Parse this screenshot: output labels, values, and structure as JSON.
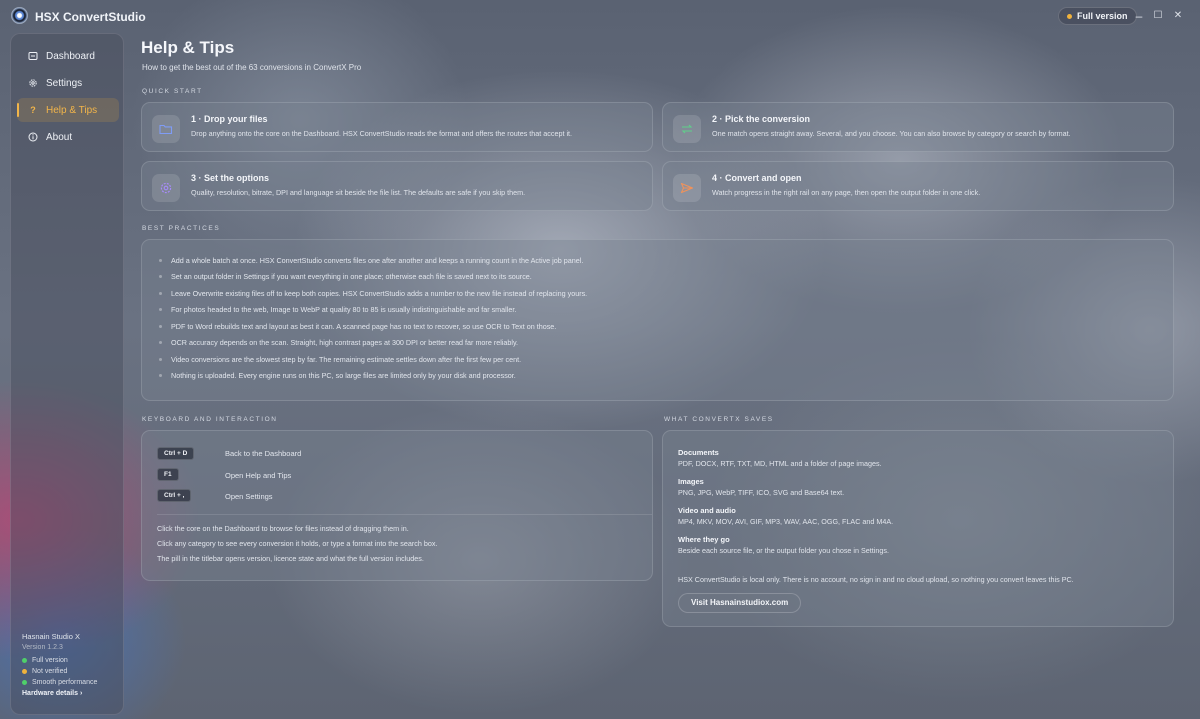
{
  "titlebar": {
    "app_title": "HSX ConvertStudio",
    "version_pill": "Full version",
    "pill_color": "#f0b23c",
    "controls": {
      "minimize": "–",
      "maximize": "☐",
      "close": "✕"
    }
  },
  "sidebar": {
    "items": [
      {
        "label": "Dashboard",
        "icon": "dashboard-icon",
        "active": false
      },
      {
        "label": "Settings",
        "icon": "gear-icon",
        "active": false
      },
      {
        "label": "Help & Tips",
        "icon": "help-icon",
        "active": true
      },
      {
        "label": "About",
        "icon": "info-icon",
        "active": false
      }
    ],
    "footer": {
      "brand": "Hasnain Studio X",
      "version": "Version 1.2.3",
      "statuses": [
        {
          "label": "Full version",
          "color": "#4fcf6a"
        },
        {
          "label": "Not verified",
          "color": "#f0b23c"
        },
        {
          "label": "Smooth performance",
          "color": "#4fcf6a"
        }
      ],
      "hardware_link": "Hardware details ›"
    }
  },
  "page": {
    "title": "Help & Tips",
    "subtitle": "How to get the best out of the 63 conversions in ConvertX Pro"
  },
  "quick_start": {
    "label": "QUICK START",
    "cards": [
      {
        "title": "1 · Drop your files",
        "text": "Drop anything onto the core on the Dashboard. HSX ConvertStudio reads the format and offers the routes that accept it.",
        "icon": "folder-icon",
        "color": "#7f9cf5"
      },
      {
        "title": "2 · Pick the conversion",
        "text": "One match opens straight away. Several, and you choose. You can also browse by category or search by format.",
        "icon": "swap-icon",
        "color": "#5fd08a"
      },
      {
        "title": "3 · Set the options",
        "text": "Quality, resolution, bitrate, DPI and language sit beside the file list. The defaults are safe if you skip them.",
        "icon": "gear-icon",
        "color": "#a78bfa"
      },
      {
        "title": "4 · Convert and open",
        "text": "Watch progress in the right rail on any page, then open the output folder in one click.",
        "icon": "send-icon",
        "color": "#f0925a"
      }
    ]
  },
  "best_practices": {
    "label": "BEST PRACTICES",
    "items": [
      "Add a whole batch at once. HSX ConvertStudio converts files one after another and keeps a running count in the Active job panel.",
      "Set an output folder in Settings if you want everything in one place; otherwise each file is saved next to its source.",
      "Leave Overwrite existing files off to keep both copies. HSX ConvertStudio adds a number to the new file instead of replacing yours.",
      "For photos headed to the web, Image to WebP at quality 80 to 85 is usually indistinguishable and far smaller.",
      "PDF to Word rebuilds text and layout as best it can. A scanned page has no text to recover, so use OCR to Text on those.",
      "OCR accuracy depends on the scan. Straight, high contrast pages at 300 DPI or better read far more reliably.",
      "Video conversions are the slowest step by far. The remaining estimate settles down after the first few per cent.",
      "Nothing is uploaded. Every engine runs on this PC, so large files are limited only by your disk and processor."
    ]
  },
  "keyboard": {
    "label": "KEYBOARD AND INTERACTION",
    "shortcuts": [
      {
        "key": "Ctrl + D",
        "desc": "Back to the Dashboard"
      },
      {
        "key": "F1",
        "desc": "Open Help and Tips"
      },
      {
        "key": "Ctrl + ,",
        "desc": "Open Settings"
      }
    ],
    "notes": [
      "Click the core on the Dashboard to browse for files instead of dragging them in.",
      "Click any category to see every conversion it holds, or type a format into the search box.",
      "The pill in the titlebar opens version, licence state and what the full version includes."
    ]
  },
  "saves": {
    "label": "WHAT CONVERTX SAVES",
    "groups": [
      {
        "head": "Documents",
        "text": "PDF, DOCX, RTF, TXT, MD, HTML and a folder of page images."
      },
      {
        "head": "Images",
        "text": "PNG, JPG, WebP, TIFF, ICO, SVG and Base64 text."
      },
      {
        "head": "Video and audio",
        "text": "MP4, MKV, MOV, AVI, GIF, MP3, WAV, AAC, OGG, FLAC and M4A."
      },
      {
        "head": "Where they go",
        "text": "Beside each source file, or the output folder you chose in Settings."
      }
    ],
    "privacy_note": "HSX ConvertStudio is local only. There is no account, no sign in and no cloud upload, so nothing you convert leaves this PC.",
    "visit_button": "Visit Hasnainstudiox.com"
  }
}
